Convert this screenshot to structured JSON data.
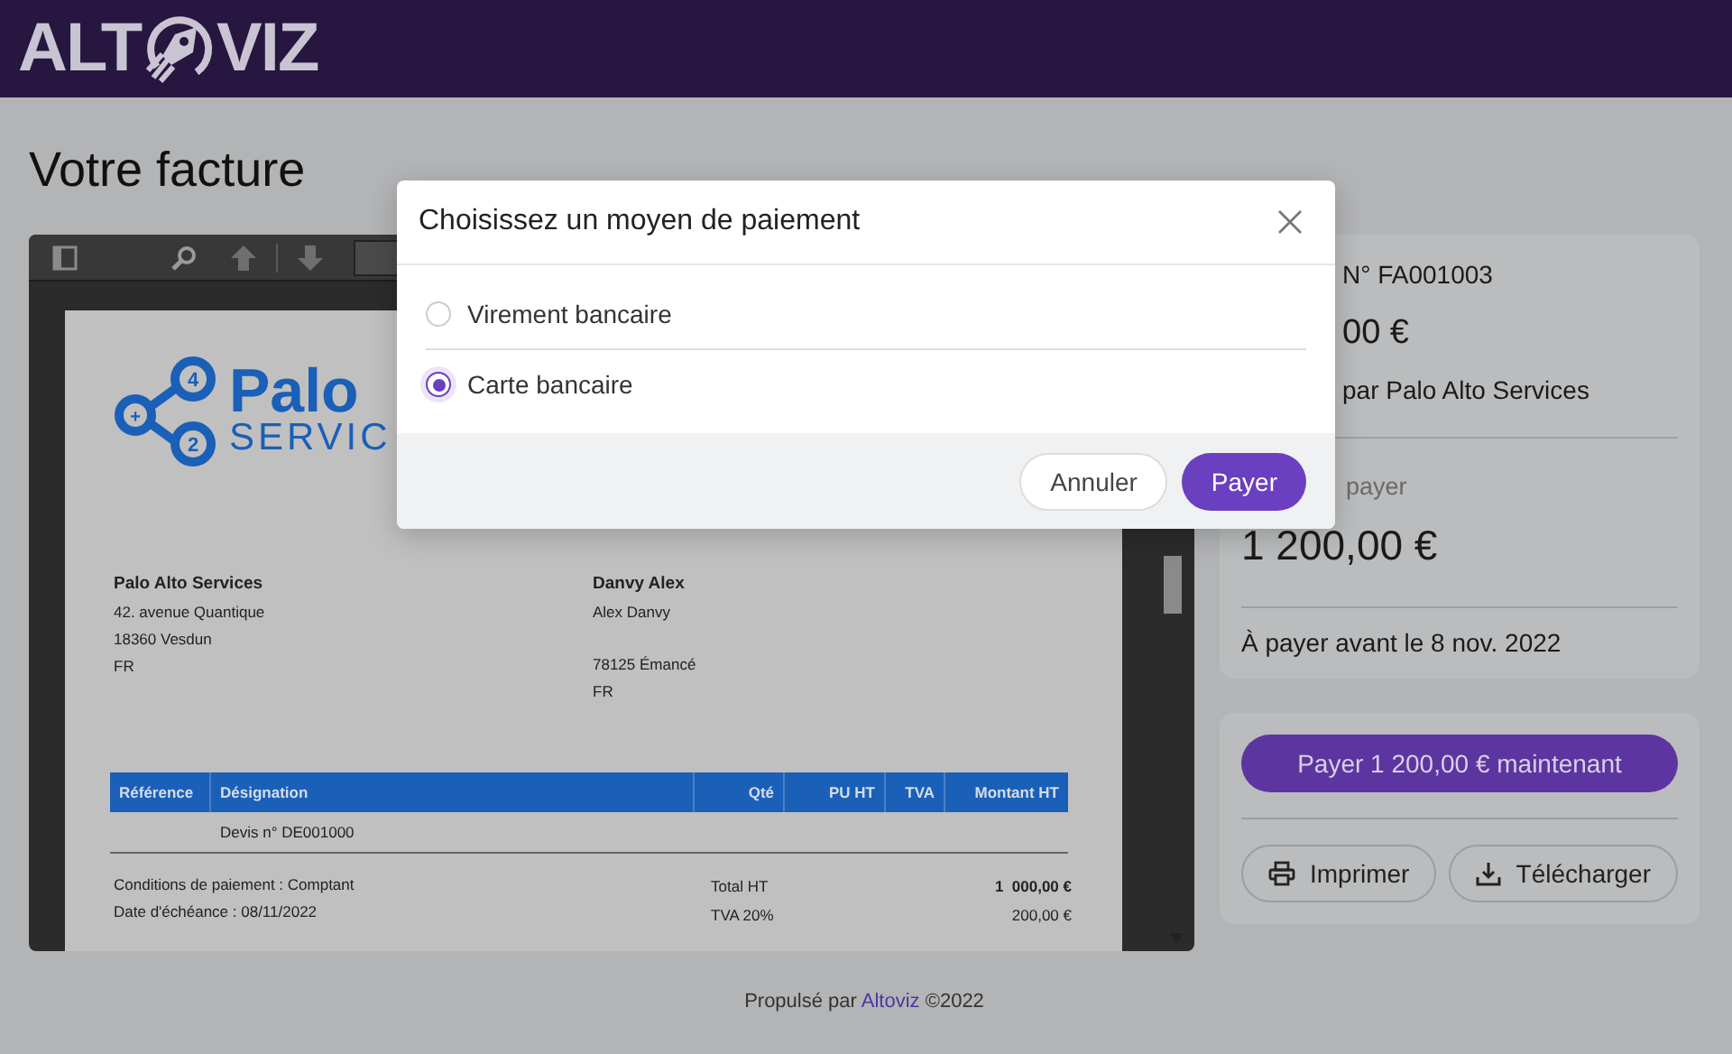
{
  "header": {
    "logo_left": "ALT",
    "logo_right": "VIZ"
  },
  "page_title": "Votre facture",
  "document": {
    "logo_text": "Palo",
    "logo_subtext": "SERVIC",
    "logo_badges": [
      "4",
      "+",
      "2"
    ],
    "sender": {
      "name": "Palo Alto Services",
      "blocks": [
        [
          "42. avenue Quantique",
          "18360 Vesdun",
          "FR"
        ]
      ]
    },
    "recipient": {
      "name": "Danvy Alex",
      "blocks": [
        [
          "Alex Danvy"
        ],
        [
          "78125 Émancé",
          "FR"
        ]
      ]
    },
    "table": {
      "columns": [
        "Référence",
        "Désignation",
        "Qté",
        "PU HT",
        "TVA",
        "Montant HT"
      ],
      "rows": [
        {
          "designation": "Devis n° DE001000"
        }
      ]
    },
    "conditions": [
      "Conditions de paiement : Comptant",
      "Date d'échéance : 08/11/2022"
    ],
    "totals": [
      {
        "label": "Total HT",
        "value": "1  000,00 €",
        "bold": true
      },
      {
        "label": "TVA 20%",
        "value": "200,00 €",
        "bold": false
      }
    ]
  },
  "summary": {
    "invoice_number": "N° FA001003",
    "amount": "00 €",
    "issuer": "par Palo Alto Services",
    "due_label": "payer",
    "due_amount": "1 200,00 €",
    "due_date": "À payer avant le 8 nov. 2022"
  },
  "actions": {
    "pay": "Payer 1 200,00 € maintenant",
    "print": "Imprimer",
    "download": "Télécharger"
  },
  "footer": {
    "prefix": "Propulsé par",
    "link": "Altoviz",
    "suffix": "©2022"
  },
  "modal": {
    "title": "Choisissez un moyen de paiement",
    "options": [
      {
        "label": "Virement bancaire",
        "selected": false
      },
      {
        "label": "Carte bancaire",
        "selected": true
      }
    ],
    "cancel": "Annuler",
    "confirm": "Payer"
  }
}
